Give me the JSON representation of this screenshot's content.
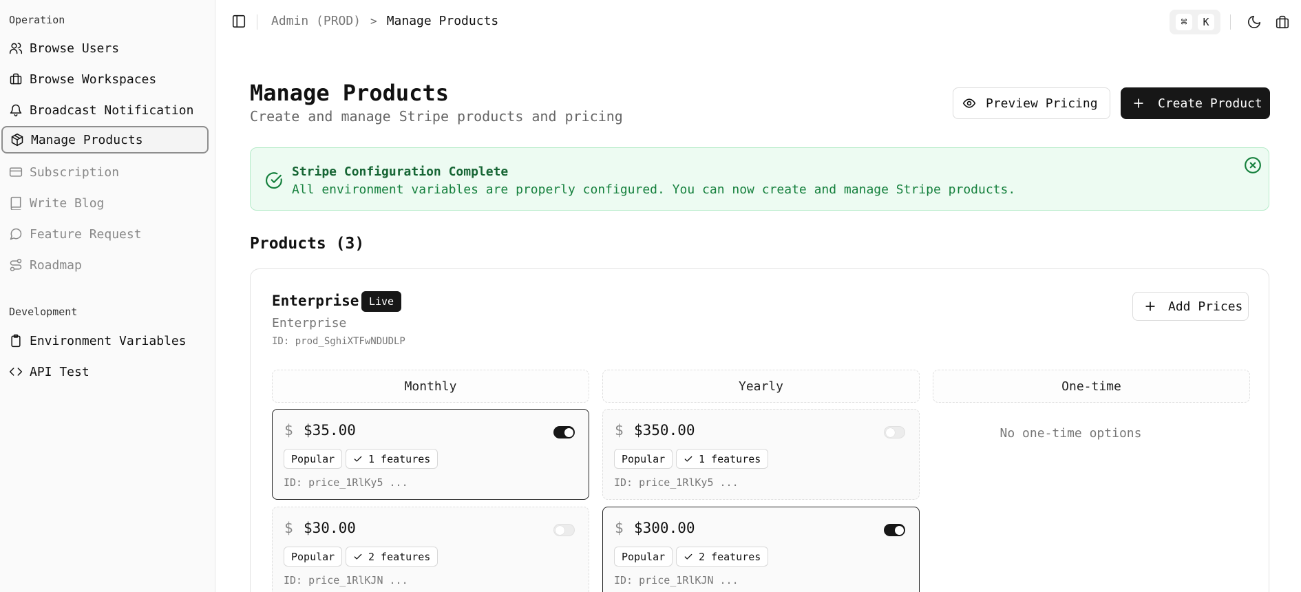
{
  "sidebar": {
    "sections": [
      {
        "label": "Operation",
        "items": [
          {
            "label": "Browse Users",
            "icon": "users-icon"
          },
          {
            "label": "Browse Workspaces",
            "icon": "briefcase-icon"
          },
          {
            "label": "Broadcast Notification",
            "icon": "bell-icon"
          },
          {
            "label": "Manage Products",
            "icon": "package-icon",
            "active": true
          },
          {
            "label": "Subscription",
            "icon": "credit-card-icon",
            "muted": true
          },
          {
            "label": "Write Blog",
            "icon": "book-icon",
            "muted": true
          },
          {
            "label": "Feature Request",
            "icon": "message-circle-icon",
            "muted": true
          },
          {
            "label": "Roadmap",
            "icon": "route-icon",
            "muted": true
          }
        ]
      },
      {
        "label": "Development",
        "items": [
          {
            "label": "Environment Variables",
            "icon": "clipboard-icon"
          },
          {
            "label": "API Test",
            "icon": "code-icon"
          }
        ]
      }
    ]
  },
  "topbar": {
    "breadcrumb": {
      "parent": "Admin (PROD)",
      "separator": ">",
      "current": "Manage Products"
    },
    "shortcut": {
      "mod": "⌘",
      "key": "K"
    },
    "icons": [
      "sidebar-toggle-icon",
      "moon-icon",
      "gift-icon"
    ]
  },
  "header": {
    "title": "Manage Products",
    "subtitle": "Create and manage Stripe products and pricing",
    "preview_label": "Preview Pricing",
    "create_label": "Create Product"
  },
  "alert": {
    "title": "Stripe Configuration Complete",
    "message": "All environment variables are properly configured. You can now create and manage Stripe products.",
    "color": "#15803d",
    "background": "#edfbf2"
  },
  "products": {
    "heading": "Products (3)",
    "items": [
      {
        "name": "Enterprise",
        "badge": "Live",
        "description": "Enterprise",
        "id": "ID: prod_SghiXTFwNDUDLP",
        "add_prices_label": "Add Prices",
        "columns": [
          {
            "label": "Monthly",
            "prices": [
              {
                "currency": "$",
                "amount": "$35.00",
                "enabled": true,
                "tag": "Popular",
                "features": "1 features",
                "id": "ID: price_1RlKy5 ..."
              },
              {
                "currency": "$",
                "amount": "$30.00",
                "enabled": false,
                "tag": "Popular",
                "features": "2 features",
                "id": "ID: price_1RlKJN ..."
              }
            ]
          },
          {
            "label": "Yearly",
            "prices": [
              {
                "currency": "$",
                "amount": "$350.00",
                "enabled": false,
                "tag": "Popular",
                "features": "1 features",
                "id": "ID: price_1RlKy5 ..."
              },
              {
                "currency": "$",
                "amount": "$300.00",
                "enabled": true,
                "tag": "Popular",
                "features": "2 features",
                "id": "ID: price_1RlKJN ..."
              }
            ]
          },
          {
            "label": "One-time",
            "empty_text": "No one-time options",
            "prices": []
          }
        ]
      }
    ]
  }
}
